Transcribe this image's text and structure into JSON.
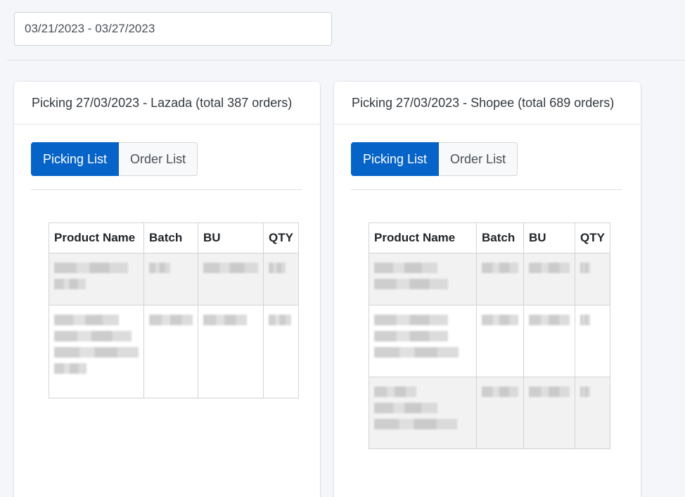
{
  "date_range": {
    "value": "03/21/2023 - 03/27/2023"
  },
  "cards": [
    {
      "title": "Picking 27/03/2023 - Lazada (total 387 orders)",
      "tabs": [
        "Picking List",
        "Order List"
      ],
      "columns": [
        "Product Name",
        "Batch",
        "BU",
        "QTY"
      ]
    },
    {
      "title": "Picking 27/03/2023 - Shopee (total 689 orders)",
      "tabs": [
        "Picking List",
        "Order List"
      ],
      "columns": [
        "Product Name",
        "Batch",
        "BU",
        "QTY"
      ]
    }
  ],
  "colors": {
    "primary": "#0664c8",
    "background": "#f4f6f9"
  }
}
